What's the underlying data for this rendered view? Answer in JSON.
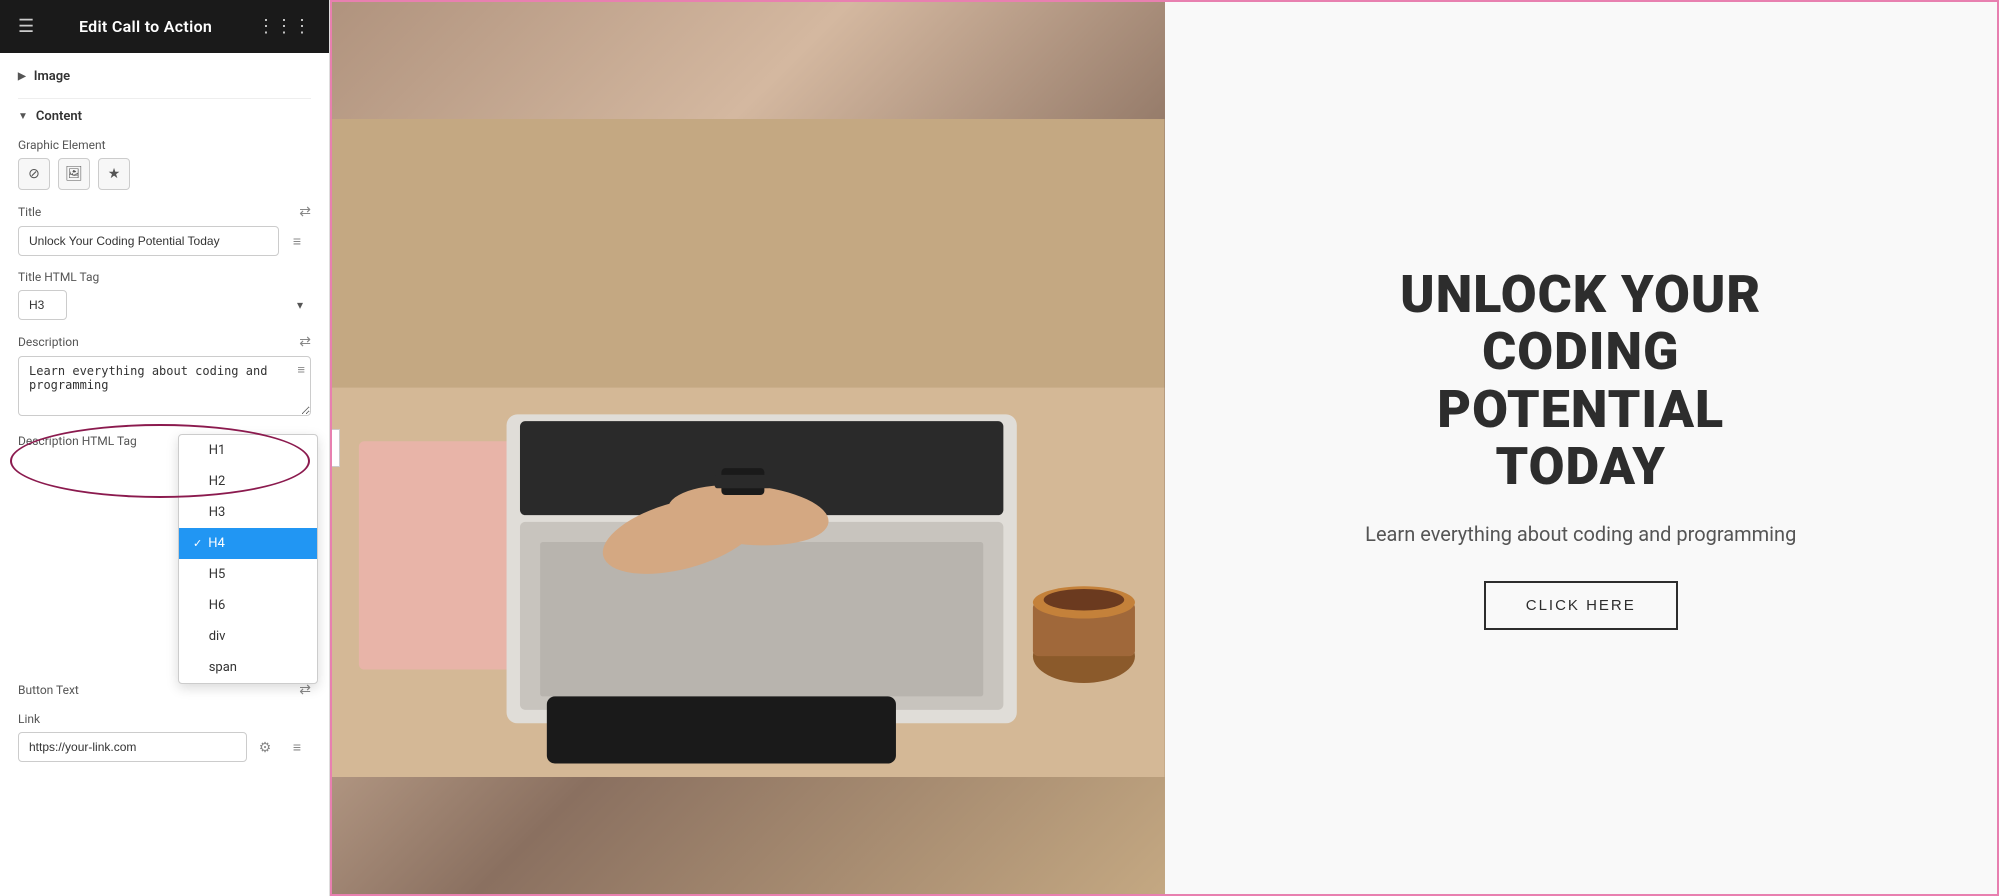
{
  "header": {
    "title": "Edit Call to Action",
    "hamburger": "☰",
    "grid": "⋮⋮⋮"
  },
  "sections": {
    "image": {
      "label": "Image",
      "collapsed": true,
      "arrow": "▶"
    },
    "content": {
      "label": "Content",
      "collapsed": false,
      "arrow": "▼"
    }
  },
  "fields": {
    "graphic_element": {
      "label": "Graphic Element",
      "btn_none": "⊘",
      "btn_image": "🖼",
      "btn_star": "★"
    },
    "title": {
      "label": "Title",
      "value": "Unlock Your Coding Potential Today",
      "dynamic_icon": "⇄"
    },
    "title_html_tag": {
      "label": "Title HTML Tag",
      "value": "H3",
      "options": [
        "H1",
        "H2",
        "H3",
        "H4",
        "H5",
        "H6",
        "div",
        "span"
      ]
    },
    "description": {
      "label": "Description",
      "value": "Learn everything about coding and programming",
      "dynamic_icon": "⇄"
    },
    "description_html_tag": {
      "label": "Description HTML Tag",
      "current_value": "H4",
      "dropdown_open": true,
      "options": [
        {
          "label": "H1",
          "selected": false
        },
        {
          "label": "H2",
          "selected": false
        },
        {
          "label": "H3",
          "selected": false
        },
        {
          "label": "H4",
          "selected": true
        },
        {
          "label": "H5",
          "selected": false
        },
        {
          "label": "H6",
          "selected": false
        },
        {
          "label": "div",
          "selected": false
        },
        {
          "label": "span",
          "selected": false
        }
      ]
    },
    "button_text": {
      "label": "Button Text",
      "dynamic_icon": "⇄"
    },
    "link": {
      "label": "Link",
      "value": "https://your-link.com",
      "settings_icon": "⚙",
      "dynamic_icon": "≡"
    }
  },
  "preview": {
    "title_line1": "UNLOCK YOUR",
    "title_line2": "CODING",
    "title_line3": "POTENTIAL",
    "title_line4": "TODAY",
    "description": "Learn everything about coding and programming",
    "button_label": "Click Here",
    "collapse_arrow": "‹"
  }
}
